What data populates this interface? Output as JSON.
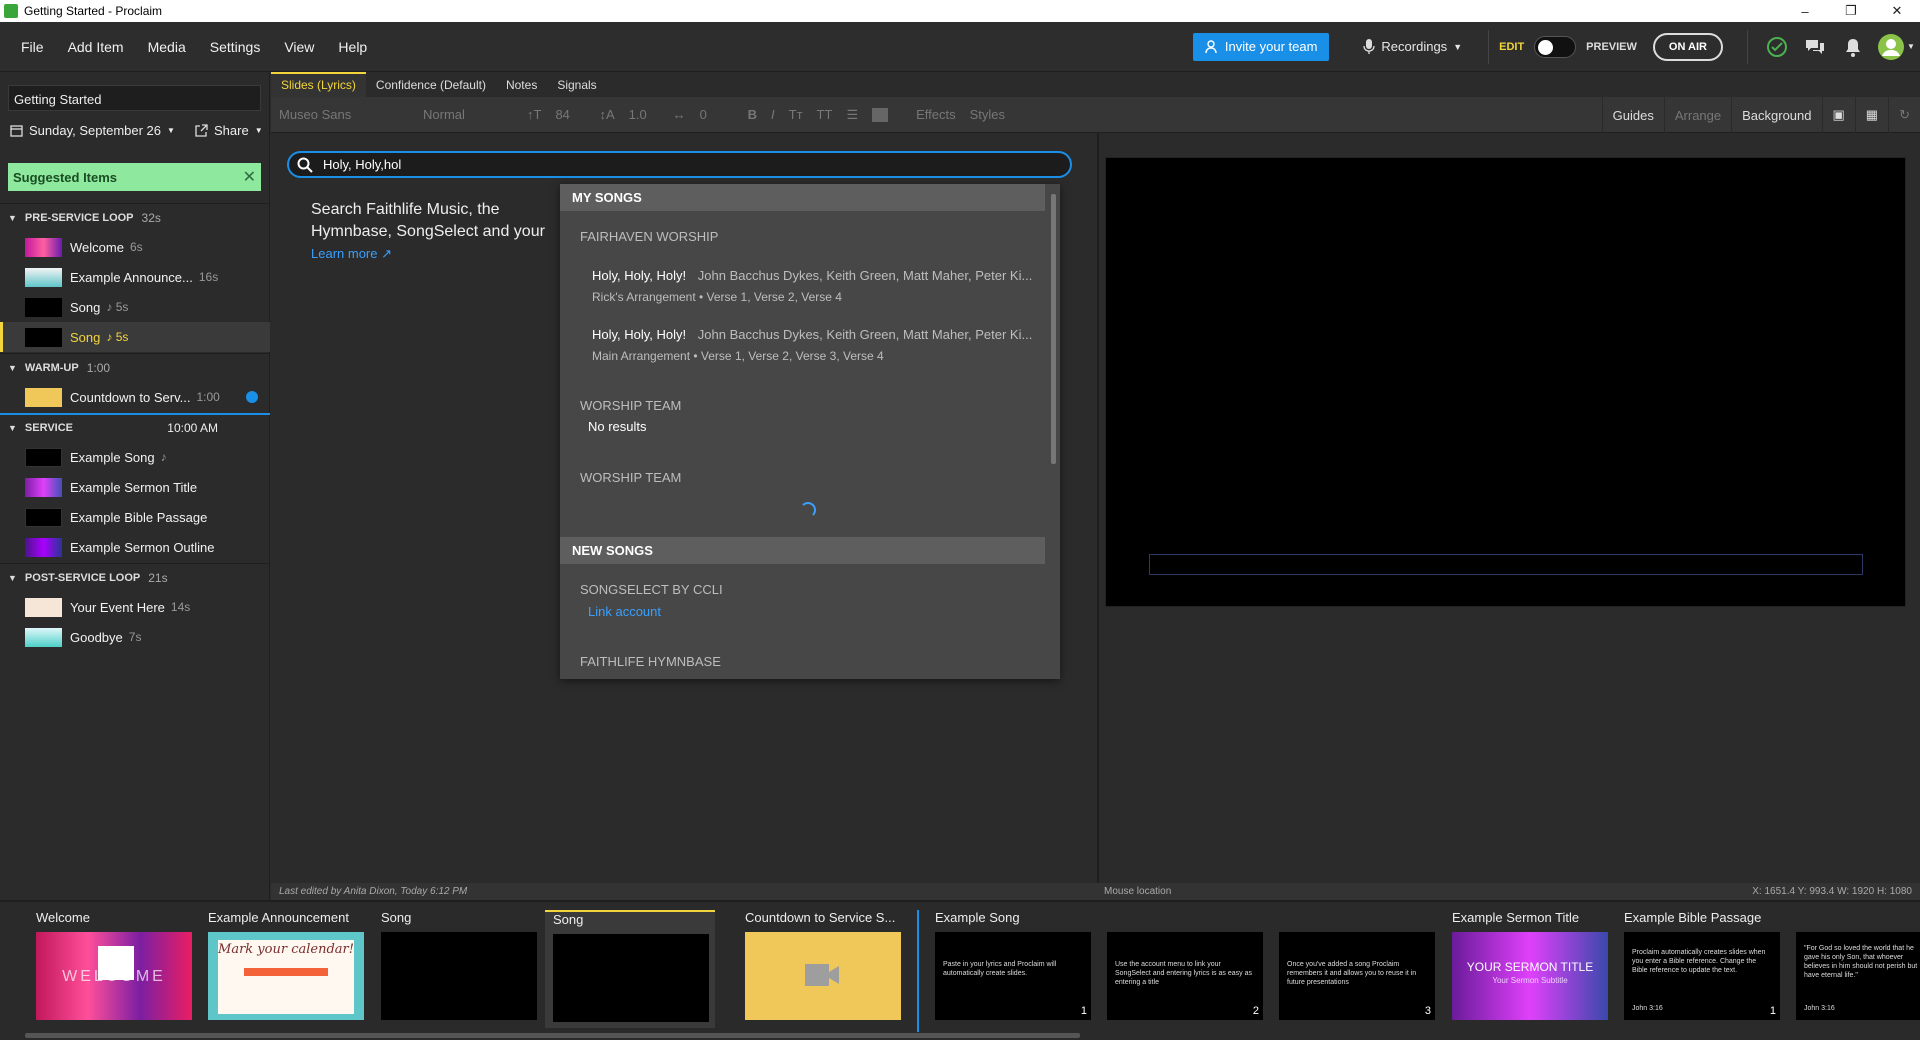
{
  "window": {
    "title": "Getting Started - Proclaim"
  },
  "menu": [
    "File",
    "Add Item",
    "Media",
    "Settings",
    "View",
    "Help"
  ],
  "topbar": {
    "invite_label": "Invite your team",
    "recordings_label": "Recordings",
    "edit_label": "EDIT",
    "preview_label": "PREVIEW",
    "onair_label": "ON AIR"
  },
  "sidebar": {
    "doc_title": "Getting Started",
    "date": "Sunday, September 26",
    "share": "Share",
    "suggested": "Suggested Items",
    "sections": [
      {
        "name": "PRE-SERVICE LOOP",
        "duration": "32s"
      },
      {
        "name": "WARM-UP",
        "duration": "1:00"
      },
      {
        "name": "SERVICE",
        "duration": "10:00 AM"
      },
      {
        "name": "POST-SERVICE LOOP",
        "duration": "21s"
      }
    ],
    "items": [
      {
        "label": "Welcome",
        "dur": "6s"
      },
      {
        "label": "Example Announce...",
        "dur": "16s"
      },
      {
        "label": "Song",
        "dur": "♪ 5s"
      },
      {
        "label": "Song",
        "dur": "♪ 5s"
      },
      {
        "label": "Countdown to Serv...",
        "dur": "1:00"
      },
      {
        "label": "Example Song",
        "dur": "♪"
      },
      {
        "label": "Example Sermon Title",
        "dur": ""
      },
      {
        "label": "Example Bible Passage",
        "dur": ""
      },
      {
        "label": "Example Sermon Outline",
        "dur": ""
      },
      {
        "label": "Your Event Here",
        "dur": "14s"
      },
      {
        "label": "Goodbye",
        "dur": "7s"
      }
    ]
  },
  "tabs": [
    "Slides (Lyrics)",
    "Confidence (Default)",
    "Notes",
    "Signals"
  ],
  "toolbar": {
    "font": "Museo Sans",
    "weight": "Normal",
    "size": "84",
    "line": "1.0",
    "spacing": "0",
    "effects": "Effects",
    "styles": "Styles",
    "guides": "Guides",
    "arrange": "Arrange",
    "background": "Background"
  },
  "search": {
    "value": "Holy, Holy,hol",
    "hint": "Search Faithlife Music, the Hymnbase, SongSelect and your songs. If you don't find what you're looking for, create a new song.",
    "learn_more": "Learn more"
  },
  "dropdown": {
    "my_songs": "MY SONGS",
    "group1": "FAIRHAVEN WORSHIP",
    "songs": [
      {
        "title": "Holy, Holy, Holy!",
        "authors": "John Bacchus Dykes, Keith Green, Matt Maher, Peter Ki...",
        "sub": "Rick's Arrangement • Verse 1, Verse 2, Verse 4"
      },
      {
        "title": "Holy, Holy, Holy!",
        "authors": "John Bacchus Dykes, Keith Green, Matt Maher, Peter Ki...",
        "sub": "Main Arrangement • Verse 1, Verse 2, Verse 3, Verse 4"
      }
    ],
    "group2": "WORSHIP TEAM",
    "no_results": "No results",
    "group3": "WORSHIP TEAM",
    "new_songs": "NEW SONGS",
    "group4": "SONGSELECT BY CCLI",
    "link_account": "Link account",
    "group5": "FAITHLIFE HYMNBASE"
  },
  "status": {
    "last_edited": "Last edited by Anita Dixon, Today 6:12 PM",
    "mouse": "Mouse location",
    "coords": "X: 1651.4  Y: 993.4  W: 1920  H: 1080"
  },
  "strip": [
    {
      "label": "Welcome",
      "text": "WELCOME",
      "num": ""
    },
    {
      "label": "Example Announcement",
      "text": "Mark your calendar!",
      "num": ""
    },
    {
      "label": "Song",
      "text": "",
      "num": ""
    },
    {
      "label": "Song",
      "text": "",
      "num": ""
    },
    {
      "label": "Countdown to Service S...",
      "text": "",
      "num": ""
    },
    {
      "label": "Example Song",
      "text": "Paste in your lyrics and Proclaim will automatically create slides.",
      "num": "1"
    },
    {
      "label": "",
      "text": "Use the account menu to link your SongSelect and entering lyrics is as easy as entering a title",
      "num": "2"
    },
    {
      "label": "",
      "text": "Once you've added a song Proclaim remembers it and allows you to reuse it in future presentations",
      "num": "3"
    },
    {
      "label": "Example Sermon Title",
      "text": "YOUR SERMON TITLE",
      "sub": "Your Sermon Subtitle",
      "num": ""
    },
    {
      "label": "Example Bible Passage",
      "text": "Proclaim automatically creates slides when you enter a Bible reference. Change the Bible reference to update the text.",
      "ref": "John 3:16",
      "num": "1"
    },
    {
      "label": "",
      "text": "\"For God so loved the world that he gave his only Son, that whoever believes in him should not perish but have eternal life.\"",
      "ref": "John 3:16",
      "num": ""
    }
  ],
  "colors": {
    "accent": "#f2d53c",
    "blue": "#1a8fe8",
    "suggest": "#8ee89e"
  }
}
